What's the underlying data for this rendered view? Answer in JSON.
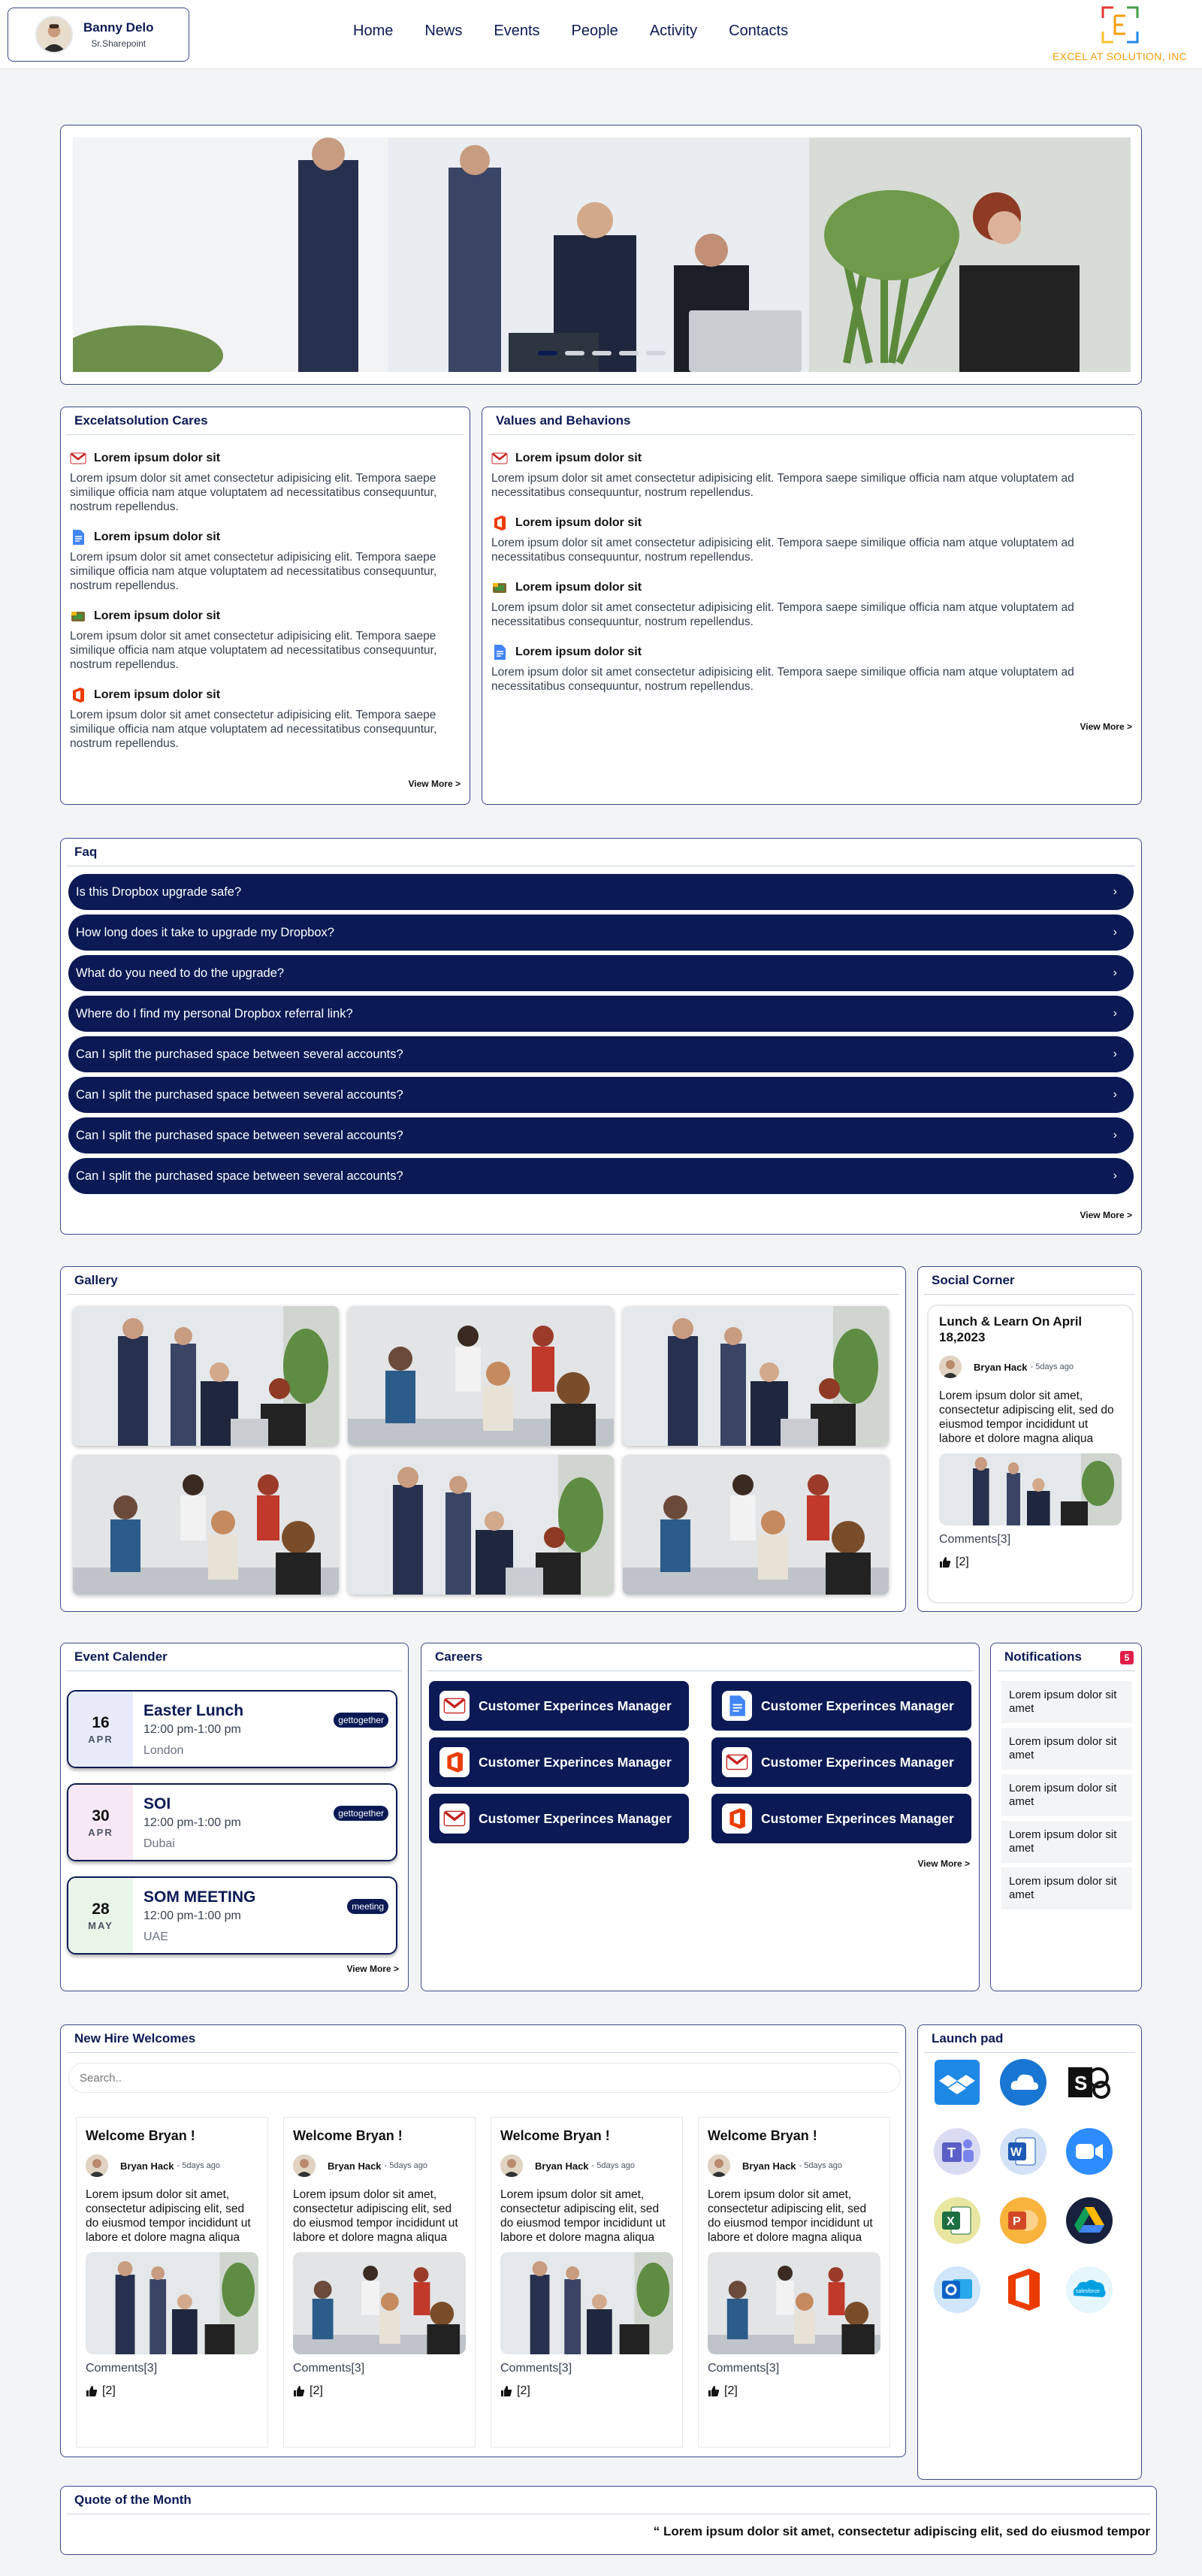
{
  "header": {
    "user_name": "Banny Delo",
    "user_role": "Sr.Sharepoint",
    "nav": [
      "Home",
      "News",
      "Events",
      "People",
      "Activity",
      "Contacts"
    ],
    "logo_text": "EXCEL AT SOLUTION, INC"
  },
  "banner": {
    "slides": 5,
    "active_slide": 0
  },
  "cares": {
    "title": "Excelatsolution Cares",
    "items": [
      {
        "icon": "gmail-icon",
        "title": "Lorem ipsum dolor sit",
        "text": "Lorem ipsum dolor sit amet consectetur adipisicing elit. Tempora saepe similique officia nam atque voluptatem ad necessitatibus consequuntur, nostrum repellendus."
      },
      {
        "icon": "google-docs-icon",
        "title": "Lorem ipsum dolor sit",
        "text": "Lorem ipsum dolor sit amet consectetur adipisicing elit. Tempora saepe similique officia nam atque voluptatem ad necessitatibus consequuntur, nostrum repellendus."
      },
      {
        "icon": "google-slides-icon",
        "title": "Lorem ipsum dolor sit",
        "text": "Lorem ipsum dolor sit amet consectetur adipisicing elit. Tempora saepe similique officia nam atque voluptatem ad necessitatibus consequuntur, nostrum repellendus."
      },
      {
        "icon": "office-icon",
        "title": "Lorem ipsum dolor sit",
        "text": "Lorem ipsum dolor sit amet consectetur adipisicing elit. Tempora saepe similique officia nam atque voluptatem ad necessitatibus consequuntur, nostrum repellendus."
      }
    ],
    "view_more": "View More >"
  },
  "values": {
    "title": "Values and Behavions",
    "items": [
      {
        "icon": "gmail-icon",
        "title": "Lorem ipsum dolor sit",
        "text": "Lorem ipsum dolor sit amet consectetur adipisicing elit. Tempora saepe similique officia nam atque voluptatem ad necessitatibus consequuntur, nostrum repellendus."
      },
      {
        "icon": "office-icon",
        "title": "Lorem ipsum dolor sit",
        "text": "Lorem ipsum dolor sit amet consectetur adipisicing elit. Tempora saepe similique officia nam atque voluptatem ad necessitatibus consequuntur, nostrum repellendus."
      },
      {
        "icon": "google-slides-icon",
        "title": "Lorem ipsum dolor sit",
        "text": "Lorem ipsum dolor sit amet consectetur adipisicing elit. Tempora saepe similique officia nam atque voluptatem ad necessitatibus consequuntur, nostrum repellendus."
      },
      {
        "icon": "google-docs-icon",
        "title": "Lorem ipsum dolor sit",
        "text": "Lorem ipsum dolor sit amet consectetur adipisicing elit. Tempora saepe similique officia nam atque voluptatem ad necessitatibus consequuntur, nostrum repellendus."
      }
    ],
    "view_more": "View More >"
  },
  "faq": {
    "title": "Faq",
    "questions": [
      "Is this Dropbox upgrade safe?",
      "How long does it take to upgrade my Dropbox?",
      "What do you need to do the upgrade?",
      "Where do I find my personal Dropbox referral link?",
      "Can I split the purchased space between several accounts?",
      "Can I split the purchased space between several accounts?",
      "Can I split the purchased space between several accounts?",
      "Can I split the purchased space between several accounts?"
    ],
    "view_more": "View More >"
  },
  "gallery": {
    "title": "Gallery"
  },
  "social": {
    "title": "Social Corner",
    "post_title": "Lunch & Learn On April 18,2023",
    "author": "Bryan Hack",
    "time": "- 5days ago",
    "body": "Lorem ipsum dolor sit amet, consectetur adipiscing elit, sed do eiusmod tempor incididunt ut labore et dolore magna aliqua",
    "comments": "Comments[3]",
    "likes": "[2]"
  },
  "events": {
    "title": "Event Calender",
    "items": [
      {
        "day": "16",
        "month": "APR",
        "title": "Easter Lunch",
        "time": "12:00 pm-1:00 pm",
        "location": "London",
        "tag": "gettogether",
        "color": "#e8ecfa"
      },
      {
        "day": "30",
        "month": "APR",
        "title": "SOI",
        "time": "12:00 pm-1:00 pm",
        "location": "Dubai",
        "tag": "gettogether",
        "color": "#f7e8f5"
      },
      {
        "day": "28",
        "month": "MAY",
        "title": "SOM MEETING",
        "time": "12:00 pm-1:00 pm",
        "location": "UAE",
        "tag": "meeting",
        "color": "#e9f5e9"
      }
    ],
    "view_more": "View More >"
  },
  "careers": {
    "title": "Careers",
    "items": [
      {
        "icon": "gmail-icon",
        "label": "Customer Experinces Manager"
      },
      {
        "icon": "google-docs-icon",
        "label": "Customer Experinces Manager"
      },
      {
        "icon": "office-icon",
        "label": "Customer Experinces Manager"
      },
      {
        "icon": "gmail-icon",
        "label": "Customer Experinces Manager"
      },
      {
        "icon": "gmail-icon",
        "label": "Customer Experinces Manager"
      },
      {
        "icon": "office-icon",
        "label": "Customer Experinces Manager"
      }
    ],
    "view_more": "View More >"
  },
  "notifications": {
    "title": "Notifications",
    "count": "5",
    "items": [
      "Lorem ipsum dolor sit amet",
      "Lorem ipsum dolor sit amet",
      "Lorem ipsum dolor sit amet",
      "Lorem ipsum dolor sit amet",
      "Lorem ipsum dolor sit amet"
    ]
  },
  "new_hire": {
    "title": "New Hire Welcomes",
    "search_placeholder": "Search..",
    "cards": [
      {
        "title": "Welcome Bryan !",
        "author": "Bryan Hack",
        "time": "- 5days ago",
        "body": "Lorem ipsum dolor sit amet, consectetur adipiscing elit, sed do eiusmod tempor incididunt ut labore et dolore magna aliqua",
        "comments": "Comments[3]",
        "likes": "[2]"
      },
      {
        "title": "Welcome Bryan !",
        "author": "Bryan Hack",
        "time": "- 5days ago",
        "body": "Lorem ipsum dolor sit amet, consectetur adipiscing elit, sed do eiusmod tempor incididunt ut labore et dolore magna aliqua",
        "comments": "Comments[3]",
        "likes": "[2]"
      },
      {
        "title": "Welcome Bryan !",
        "author": "Bryan Hack",
        "time": "- 5days ago",
        "body": "Lorem ipsum dolor sit amet, consectetur adipiscing elit, sed do eiusmod tempor incididunt ut labore et dolore magna aliqua",
        "comments": "Comments[3]",
        "likes": "[2]"
      },
      {
        "title": "Welcome Bryan !",
        "author": "Bryan Hack",
        "time": "- 5days ago",
        "body": "Lorem ipsum dolor sit amet, consectetur adipiscing elit, sed do eiusmod tempor incididunt ut labore et dolore magna aliqua",
        "comments": "Comments[3]",
        "likes": "[2]"
      }
    ]
  },
  "launch_pad": {
    "title": "Launch pad",
    "apps": [
      {
        "icon": "dropbox-icon",
        "color": "#1e88e5"
      },
      {
        "icon": "onedrive-icon",
        "color": "#1976d2"
      },
      {
        "icon": "sharepoint-icon",
        "color": "#111111"
      },
      {
        "icon": "teams-icon",
        "color": "#5b5fc7"
      },
      {
        "icon": "word-icon",
        "color": "#1e5ab5"
      },
      {
        "icon": "zoom-icon",
        "color": "#2d8cff"
      },
      {
        "icon": "excel-icon",
        "color": "#1d6f42"
      },
      {
        "icon": "powerpoint-icon",
        "color": "#d24726"
      },
      {
        "icon": "google-drive-icon",
        "color": "#0f9d58"
      },
      {
        "icon": "outlook-icon",
        "color": "#0a64c8"
      },
      {
        "icon": "office-icon",
        "color": "#eb3c00"
      },
      {
        "icon": "salesforce-icon",
        "color": "#00a1e0",
        "label": "salesforce"
      }
    ]
  },
  "quote": {
    "title": "Quote of the Month",
    "text": "“ Lorem ipsum dolor sit amet, consectetur adipiscing elit, sed do eiusmod tempor"
  },
  "colors": {
    "primary": "#0b1a55",
    "accent": "#f59e0b",
    "badge": "#e11d48"
  }
}
